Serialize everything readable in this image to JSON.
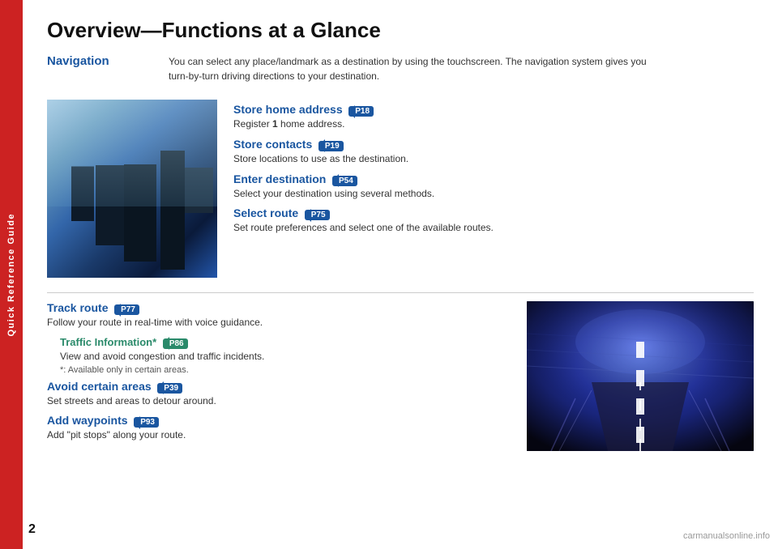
{
  "sidebar": {
    "label": "Quick Reference Guide"
  },
  "page": {
    "title": "Overview—Functions at a Glance"
  },
  "navigation": {
    "heading": "Navigation",
    "description_line1": "You can select any place/landmark as a destination by using the touchscreen. The navigation system gives you",
    "description_line2": "turn-by-turn driving directions to your destination."
  },
  "items": [
    {
      "heading": "Store home address",
      "ref": "P18",
      "desc": "Register 1 home address.",
      "color": "blue"
    },
    {
      "heading": "Store contacts",
      "ref": "P19",
      "desc": "Store locations to use as the destination.",
      "color": "blue"
    },
    {
      "heading": "Enter destination",
      "ref": "P54",
      "desc": "Select your destination using several methods.",
      "color": "blue"
    },
    {
      "heading": "Select route",
      "ref": "P75",
      "desc": "Set route preferences and select one of the available routes.",
      "color": "blue"
    }
  ],
  "bottom_items": [
    {
      "heading": "Track route",
      "ref": "P77",
      "desc": "Follow your route in real-time with voice guidance.",
      "color": "blue"
    },
    {
      "heading": "Traffic Information*",
      "ref": "P86",
      "desc": "View and avoid congestion and traffic incidents.",
      "note": "*: Available only in certain areas.",
      "color": "teal"
    },
    {
      "heading": "Avoid certain areas",
      "ref": "P39",
      "desc": "Set streets and areas to detour around.",
      "color": "blue"
    },
    {
      "heading": "Add waypoints",
      "ref": "P93",
      "desc": "Add \"pit stops\" along your route.",
      "color": "blue"
    }
  ],
  "page_number": "2",
  "watermark": "carmanualsonline.info"
}
